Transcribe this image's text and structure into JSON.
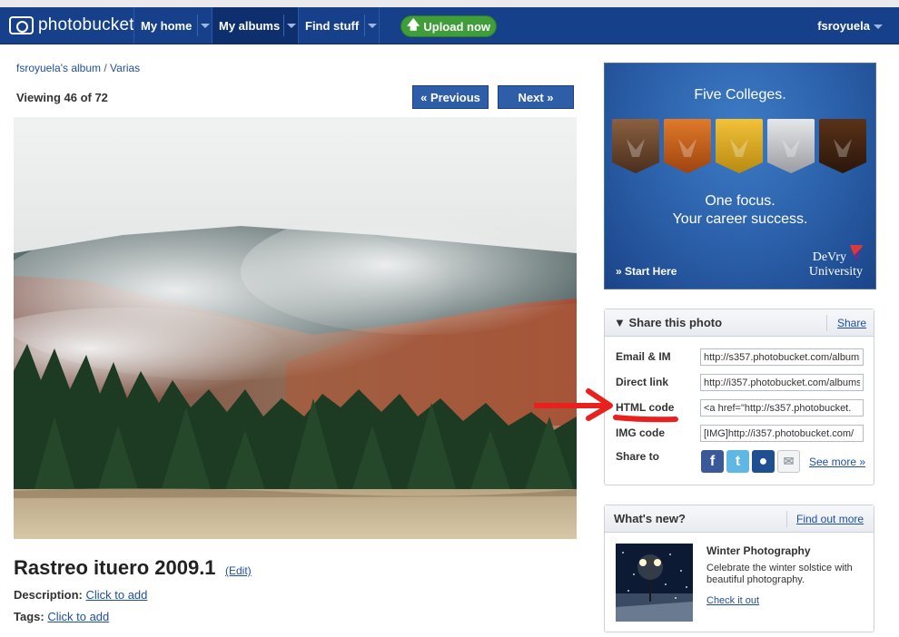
{
  "nav": {
    "logo": "photobucket",
    "items": [
      "My home",
      "My albums",
      "Find stuff"
    ],
    "upload": "Upload now",
    "user": "fsroyuela"
  },
  "breadcrumb": {
    "album": "fsroyuela's album",
    "sep": "/",
    "sub": "Varias"
  },
  "viewer": {
    "viewing": "Viewing 46 of 72",
    "prev": "« Previous",
    "next": "Next »"
  },
  "photo": {
    "title": "Rastreo ituero 2009.1",
    "edit": "(Edit)",
    "description_label": "Description:",
    "description_value": "Click to add",
    "tags_label": "Tags:",
    "tags_value": "Click to add"
  },
  "ad": {
    "headline": "Five Colleges.",
    "line1": "One focus.",
    "line2": "Your career success.",
    "cta": "» Start Here",
    "brand1": "DeVry",
    "brand2": "University",
    "shield_colors": [
      "#6e4a2e",
      "#c8611c",
      "#e0a81c",
      "#c7c9cc",
      "#4a2a15"
    ]
  },
  "share": {
    "title": "▼ Share this photo",
    "header_link": "Share",
    "rows": [
      {
        "label": "Email & IM",
        "value": "http://s357.photobucket.com/albums"
      },
      {
        "label": "Direct link",
        "value": "http://i357.photobucket.com/albums"
      },
      {
        "label": "HTML code",
        "value": "<a href=\"http://s357.photobucket."
      },
      {
        "label": "IMG code",
        "value": "[IMG]http://i357.photobucket.com/"
      }
    ],
    "share_to": "Share to",
    "social": [
      "facebook-icon",
      "twitter-icon",
      "myspace-icon",
      "email-icon"
    ],
    "see_more": "See more »"
  },
  "whatsnew": {
    "title": "What's new?",
    "link": "Find out more",
    "item_title": "Winter Photography",
    "item_desc": "Celebrate the winter solstice with beautiful photography.",
    "item_link": "Check it out"
  }
}
